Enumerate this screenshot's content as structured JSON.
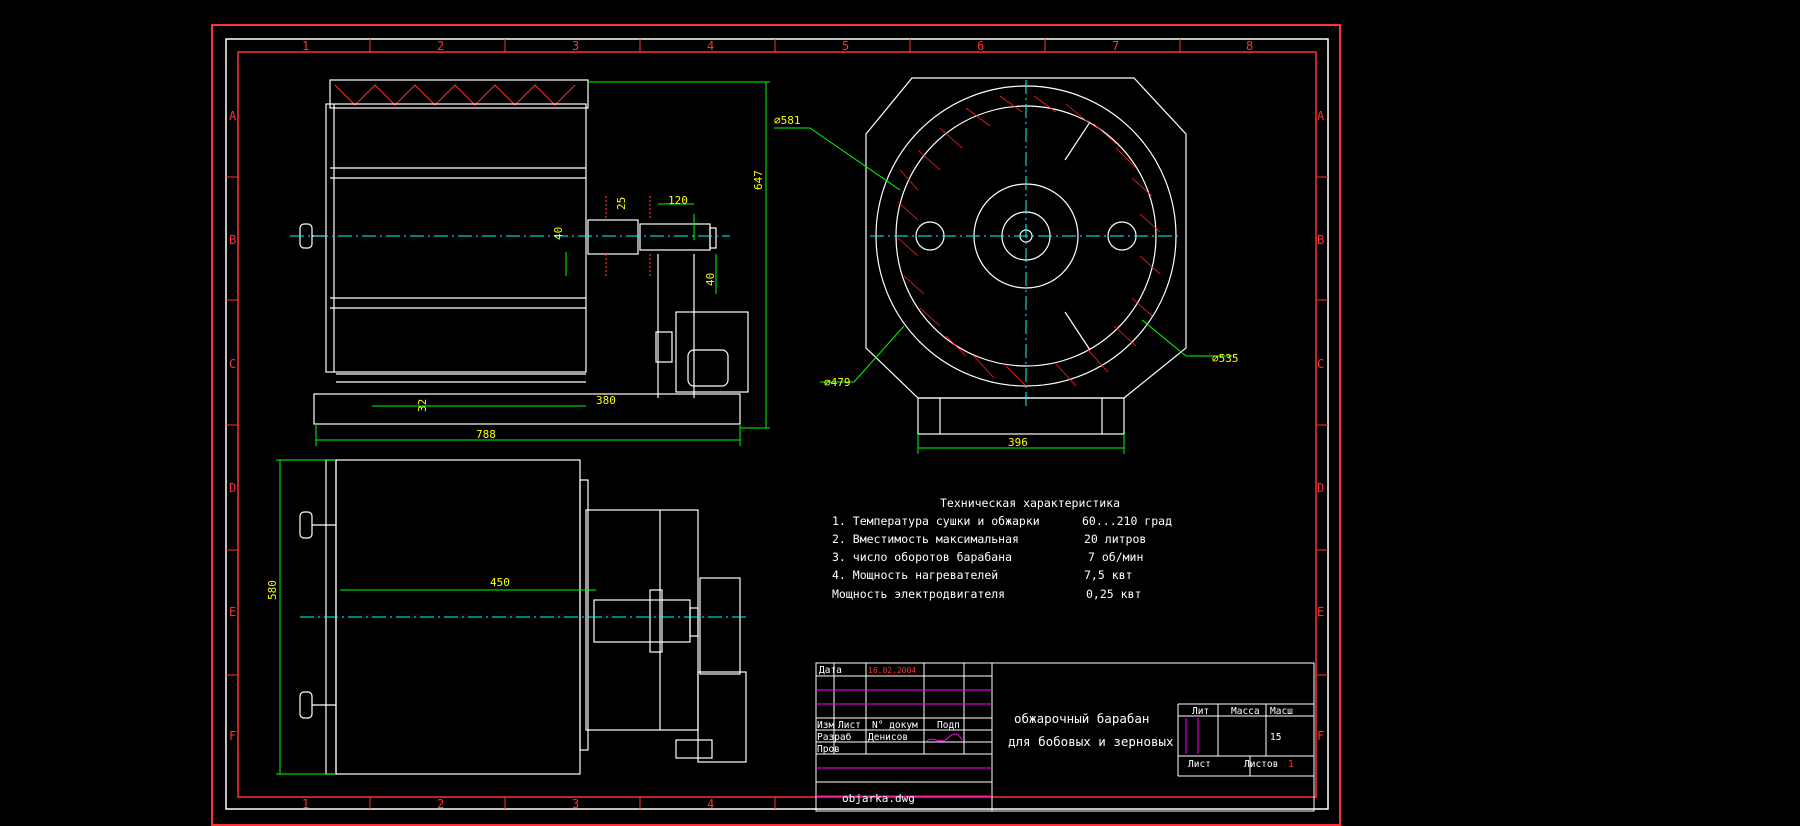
{
  "drawing": {
    "file_name": "objarka.dwg",
    "title_line1": "обжарочный барабан",
    "title_line2": "для бобовых и зерновых"
  },
  "frame": {
    "columns": [
      "1",
      "2",
      "3",
      "4",
      "5",
      "6",
      "7",
      "8"
    ],
    "rows": [
      "A",
      "B",
      "C",
      "D",
      "E",
      "F"
    ],
    "bottom_columns": [
      "1",
      "2",
      "3",
      "4"
    ]
  },
  "dimensions": {
    "d581": "⌀581",
    "d535": "⌀535",
    "d479": "⌀479",
    "h647": "647",
    "w788": "788",
    "w380": "380",
    "w32": "32",
    "w120": "120",
    "w25": "25",
    "w40a": "40",
    "w40b": "40",
    "w396": "396",
    "w450": "450",
    "h580": "580"
  },
  "specs": {
    "heading": "Техническая характеристика",
    "items": [
      {
        "label": "1. Температура сушки и обжарки",
        "value": "60...210 град"
      },
      {
        "label": "2. Вместимость максимальная",
        "value": "20 литров"
      },
      {
        "label": "3. число оборотов барабана",
        "value": "7 об/мин"
      },
      {
        "label": "4. Мощность нагревателей",
        "value": "7,5 квт"
      },
      {
        "label": "Мощность электродвигателя",
        "value": "0,25 квт"
      }
    ]
  },
  "title_block": {
    "date_label": "Дата",
    "date_value": "16.02.2004",
    "izm": "Изм",
    "list": "Лист",
    "ndoc": "N° докум",
    "podp": "Подп",
    "razrab": "Разраб",
    "razrab_name": "Денисов",
    "prov": "Пров",
    "lit": "Лит",
    "massa": "Масса",
    "masht": "Масш",
    "scale_value": "15",
    "sheet": "Лист",
    "sheets": "Листов",
    "sheets_value": "1"
  },
  "colors": {
    "background": "#000000",
    "frame_red": "#ff3030",
    "line_white": "#ffffff",
    "dim_green": "#00ff00",
    "text_yellow": "#ffff00",
    "center_cyan": "#00ffff",
    "hatch_red": "#ff2020",
    "magenta": "#ff00ff"
  }
}
